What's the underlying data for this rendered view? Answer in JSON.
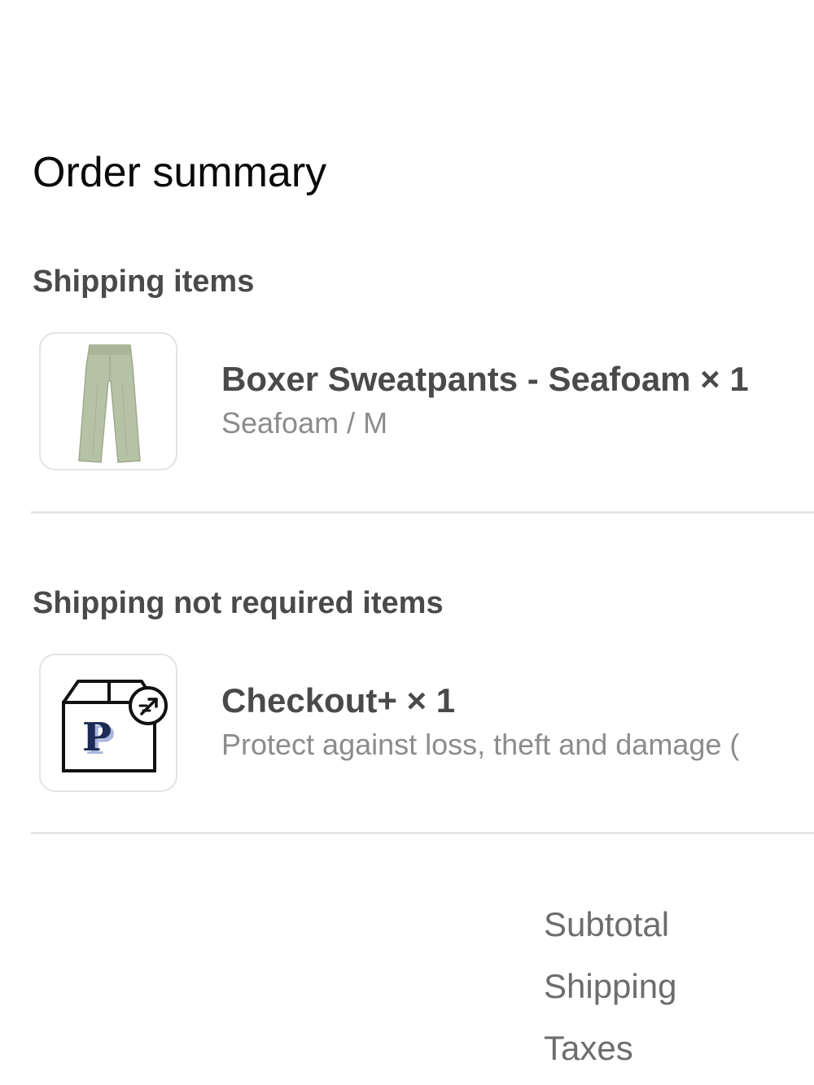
{
  "page_title": "Order summary",
  "shipping_section": {
    "heading": "Shipping items",
    "items": [
      {
        "name": "Boxer Sweatpants - Seafoam × 1",
        "variant": "Seafoam / M",
        "icon": "sweatpants-product-image",
        "color": "#b6c2a6"
      }
    ]
  },
  "no_shipping_section": {
    "heading": "Shipping not required items",
    "items": [
      {
        "name": "Checkout+ × 1",
        "description": "Protect against loss, theft and damage (",
        "icon": "package-protection-icon",
        "logo_letter": "P",
        "colors": {
          "letter": "#1c2a55",
          "shadow": "#a9b6dd"
        }
      }
    ]
  },
  "totals": {
    "subtotal_label": "Subtotal",
    "shipping_label": "Shipping",
    "taxes_label": "Taxes"
  }
}
